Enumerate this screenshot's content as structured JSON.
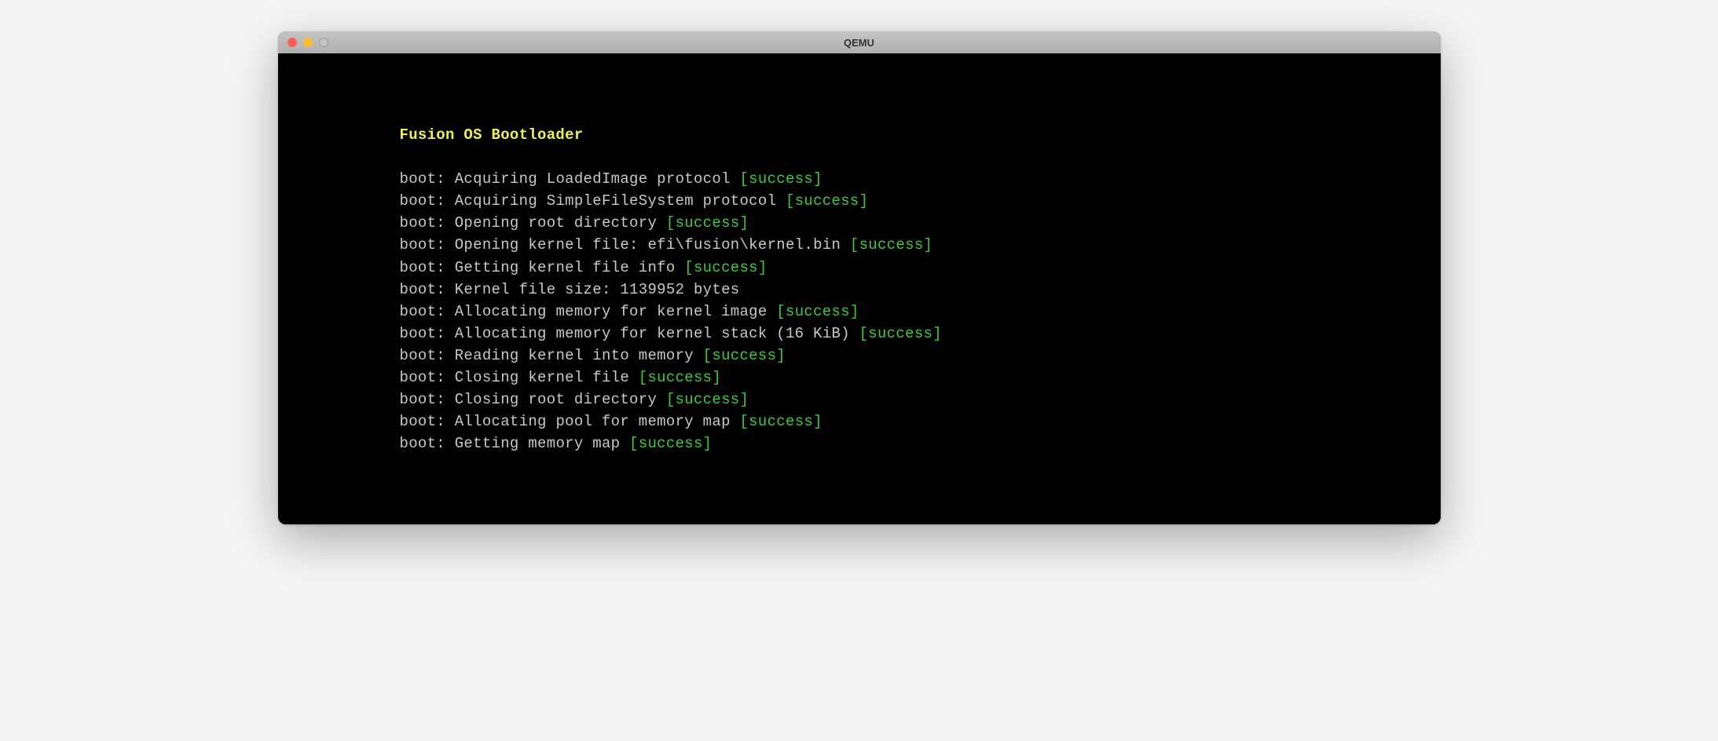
{
  "window": {
    "title": "QEMU"
  },
  "terminal": {
    "heading": "Fusion OS Bootloader",
    "lines": [
      {
        "prefix": "boot: ",
        "message": "Acquiring LoadedImage protocol ",
        "status": "[success]"
      },
      {
        "prefix": "boot: ",
        "message": "Acquiring SimpleFileSystem protocol ",
        "status": "[success]"
      },
      {
        "prefix": "boot: ",
        "message": "Opening root directory ",
        "status": "[success]"
      },
      {
        "prefix": "boot: ",
        "message": "Opening kernel file: efi\\fusion\\kernel.bin ",
        "status": "[success]"
      },
      {
        "prefix": "boot: ",
        "message": "Getting kernel file info ",
        "status": "[success]"
      },
      {
        "prefix": "boot: ",
        "message": "Kernel file size: 1139952 bytes",
        "status": ""
      },
      {
        "prefix": "boot: ",
        "message": "Allocating memory for kernel image ",
        "status": "[success]"
      },
      {
        "prefix": "boot: ",
        "message": "Allocating memory for kernel stack (16 KiB) ",
        "status": "[success]"
      },
      {
        "prefix": "boot: ",
        "message": "Reading kernel into memory ",
        "status": "[success]"
      },
      {
        "prefix": "boot: ",
        "message": "Closing kernel file ",
        "status": "[success]"
      },
      {
        "prefix": "boot: ",
        "message": "Closing root directory ",
        "status": "[success]"
      },
      {
        "prefix": "boot: ",
        "message": "Allocating pool for memory map ",
        "status": "[success]"
      },
      {
        "prefix": "boot: ",
        "message": "Getting memory map ",
        "status": "[success]"
      }
    ]
  }
}
